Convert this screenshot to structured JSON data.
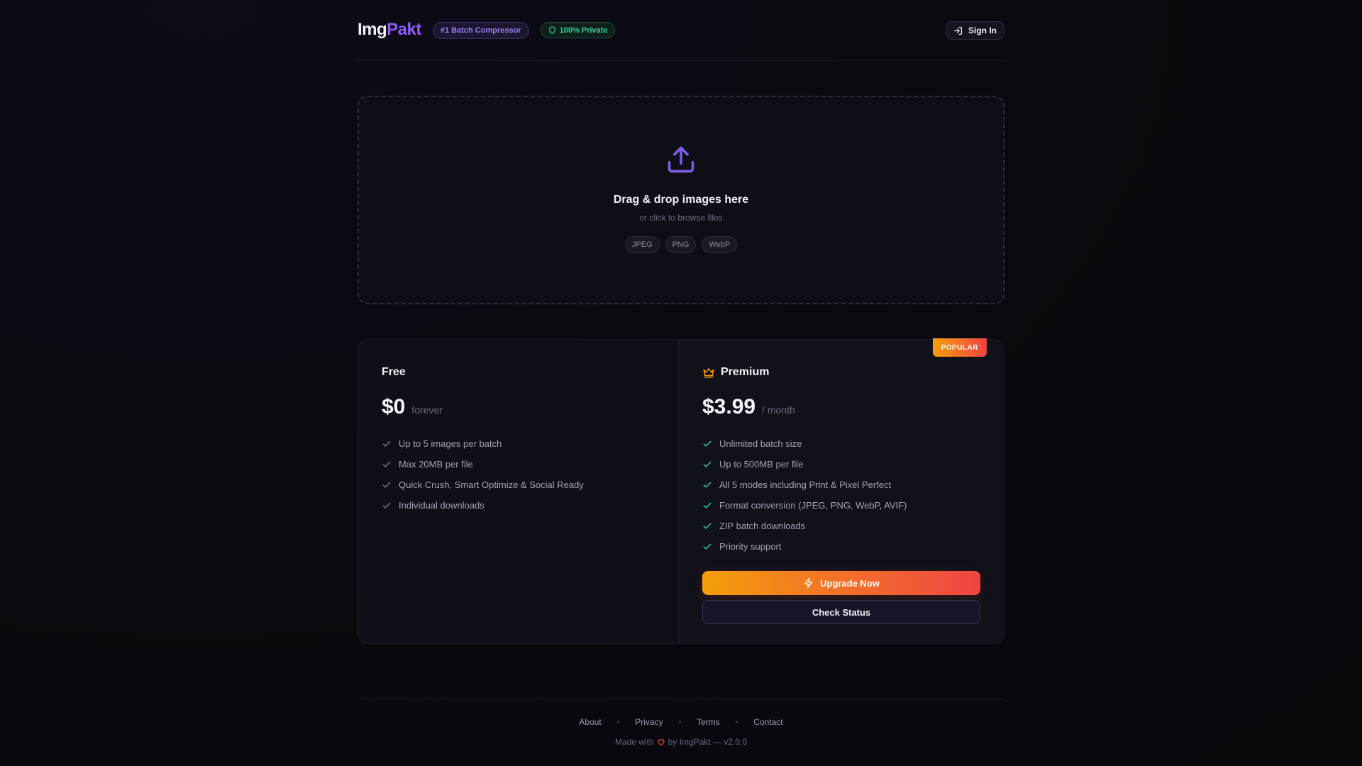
{
  "header": {
    "logo_part1": "Img",
    "logo_part2": "Pakt",
    "badge_batch": "#1 Batch Compressor",
    "badge_private": "100% Private",
    "signin_label": "Sign In"
  },
  "dropzone": {
    "title": "Drag & drop images here",
    "subtitle": "or click to browse files",
    "formats": [
      "JPEG",
      "PNG",
      "WebP"
    ]
  },
  "plans": {
    "free": {
      "name": "Free",
      "price": "$0",
      "period": "forever",
      "features": [
        "Up to 5 images per batch",
        "Max 20MB per file",
        "Quick Crush, Smart Optimize & Social Ready",
        "Individual downloads"
      ]
    },
    "premium": {
      "badge": "POPULAR",
      "name": "Premium",
      "price": "$3.99",
      "period": "/ month",
      "features": [
        "Unlimited batch size",
        "Up to 500MB per file",
        "All 5 modes including Print & Pixel Perfect",
        "Format conversion (JPEG, PNG, WebP, AVIF)",
        "ZIP batch downloads",
        "Priority support"
      ],
      "upgrade_label": "Upgrade Now",
      "status_label": "Check Status"
    }
  },
  "footer": {
    "links": [
      "About",
      "Privacy",
      "Terms",
      "Contact"
    ],
    "made_prefix": "Made with",
    "made_suffix": "by ImgPakt — v2.0.0"
  },
  "colors": {
    "accent": "#8b5cf6",
    "success": "#34d399",
    "gradient_start": "#f59e0b",
    "gradient_end": "#ef4444"
  },
  "icons": {
    "upload": "upload-icon",
    "shield": "shield-icon",
    "signin": "sign-in-icon",
    "crown": "crown-icon",
    "check": "check-icon",
    "bolt": "lightning-icon",
    "heart": "heart-icon"
  }
}
